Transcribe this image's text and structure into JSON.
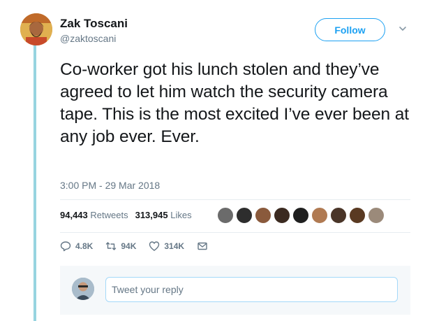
{
  "author": {
    "name": "Zak Toscani",
    "handle": "@zaktoscani"
  },
  "follow_label": "Follow",
  "tweet": {
    "text": "Co-worker got his lunch stolen and they’ve agreed to let him watch the security camera tape. This is the most excited I’ve ever been at any job ever. Ever.",
    "timestamp": "3:00 PM - 29 Mar 2018"
  },
  "stats": {
    "retweets_count": "94,443",
    "retweets_label": "Retweets",
    "likes_count": "313,945",
    "likes_label": "Likes"
  },
  "likers": [
    "#6b6b6b",
    "#2d2d2d",
    "#8a5a3c",
    "#3b2a20",
    "#1f1f1f",
    "#b07a52",
    "#4a3528",
    "#5a3a22",
    "#9b8a7a"
  ],
  "actions": {
    "replies": "4.8K",
    "retweets": "94K",
    "likes": "314K"
  },
  "reply": {
    "placeholder": "Tweet your reply"
  },
  "colors": {
    "accent": "#1da1f2",
    "thread_line": "#97d4e0",
    "secondary_text": "#657786"
  }
}
